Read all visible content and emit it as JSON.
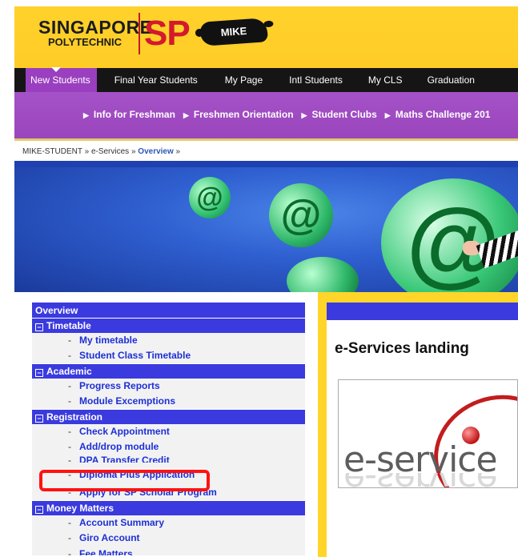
{
  "header": {
    "logo_line1": "SINGAPORE",
    "logo_line2": "POLYTECHNIC",
    "logo_sp": "SP",
    "logo_mike": "MIKE"
  },
  "nav_main": [
    "New Students",
    "Final Year Students",
    "My Page",
    "Intl Students",
    "My CLS",
    "Graduation"
  ],
  "nav_sub": [
    "Info for Freshman",
    "Freshmen Orientation",
    "Student Clubs",
    "Maths Challenge 201"
  ],
  "breadcrumb": {
    "prefix": "MIKE-STUDENT » e-Services » ",
    "current": "Overview",
    "suffix": " »"
  },
  "sidebar": {
    "overview": "Overview",
    "sections": [
      {
        "title": "Timetable",
        "items": [
          "My timetable",
          "Student Class Timetable"
        ]
      },
      {
        "title": "Academic",
        "items": [
          "Progress Reports",
          "Module Excemptions"
        ]
      },
      {
        "title": "Registration",
        "items": [
          "Check Appointment",
          "Add/drop module",
          "DPA Transfer Credit",
          "Diploma Plus Application",
          "Apply for SP Scholar Program"
        ]
      },
      {
        "title": "Money Matters",
        "items": [
          "Account Summary",
          "Giro Account",
          "Fee Matters"
        ]
      }
    ]
  },
  "main": {
    "title": "e-Services landing",
    "logo_text": "e-service"
  },
  "colors": {
    "brand_yellow": "#ffd52a",
    "nav_purple": "#9a45bc",
    "section_blue": "#3a3adf",
    "link_blue": "#1d2fd6",
    "highlight_red": "#ff1212"
  }
}
